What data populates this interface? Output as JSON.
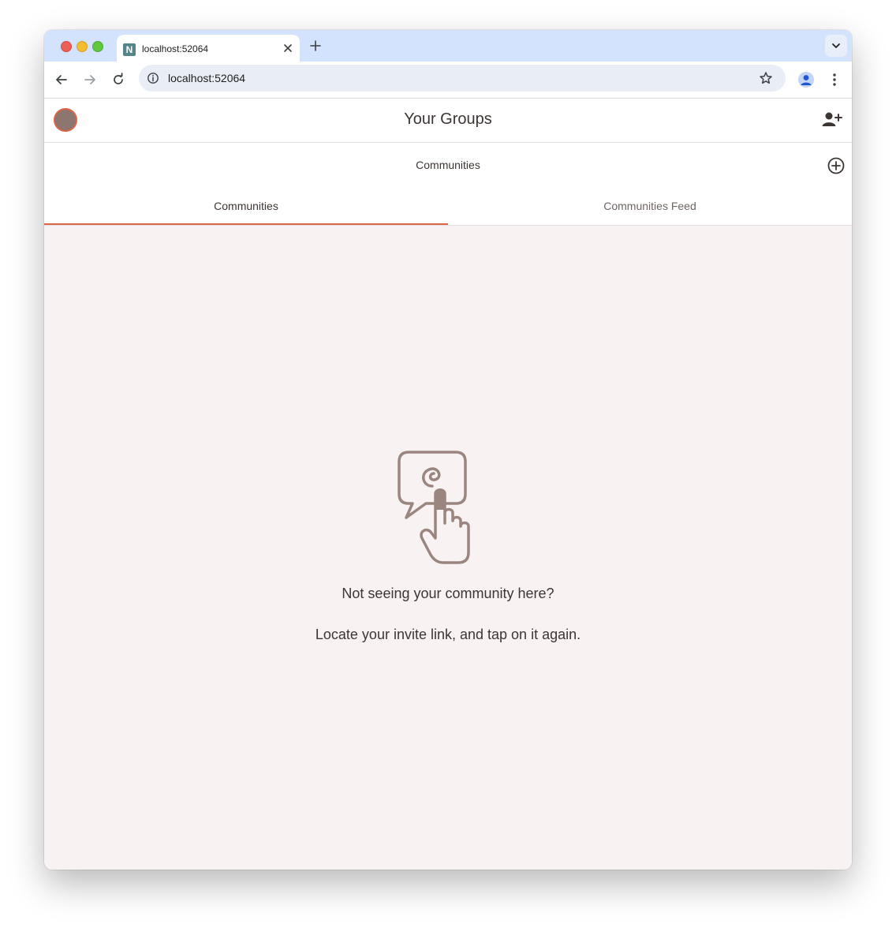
{
  "browser": {
    "tab_title": "localhost:52064",
    "tab_favicon_letter": "N",
    "url": "localhost:52064"
  },
  "header": {
    "title": "Your Groups"
  },
  "section": {
    "title": "Communities"
  },
  "tabs": [
    {
      "label": "Communities",
      "active": true
    },
    {
      "label": "Communities Feed",
      "active": false
    }
  ],
  "empty_state": {
    "line1": "Not seeing your community here?",
    "line2": "Locate your invite link, and tap on it again."
  },
  "colors": {
    "accent": "#db6446",
    "illustration": "#9b857f",
    "background": "#f8f3f2"
  }
}
